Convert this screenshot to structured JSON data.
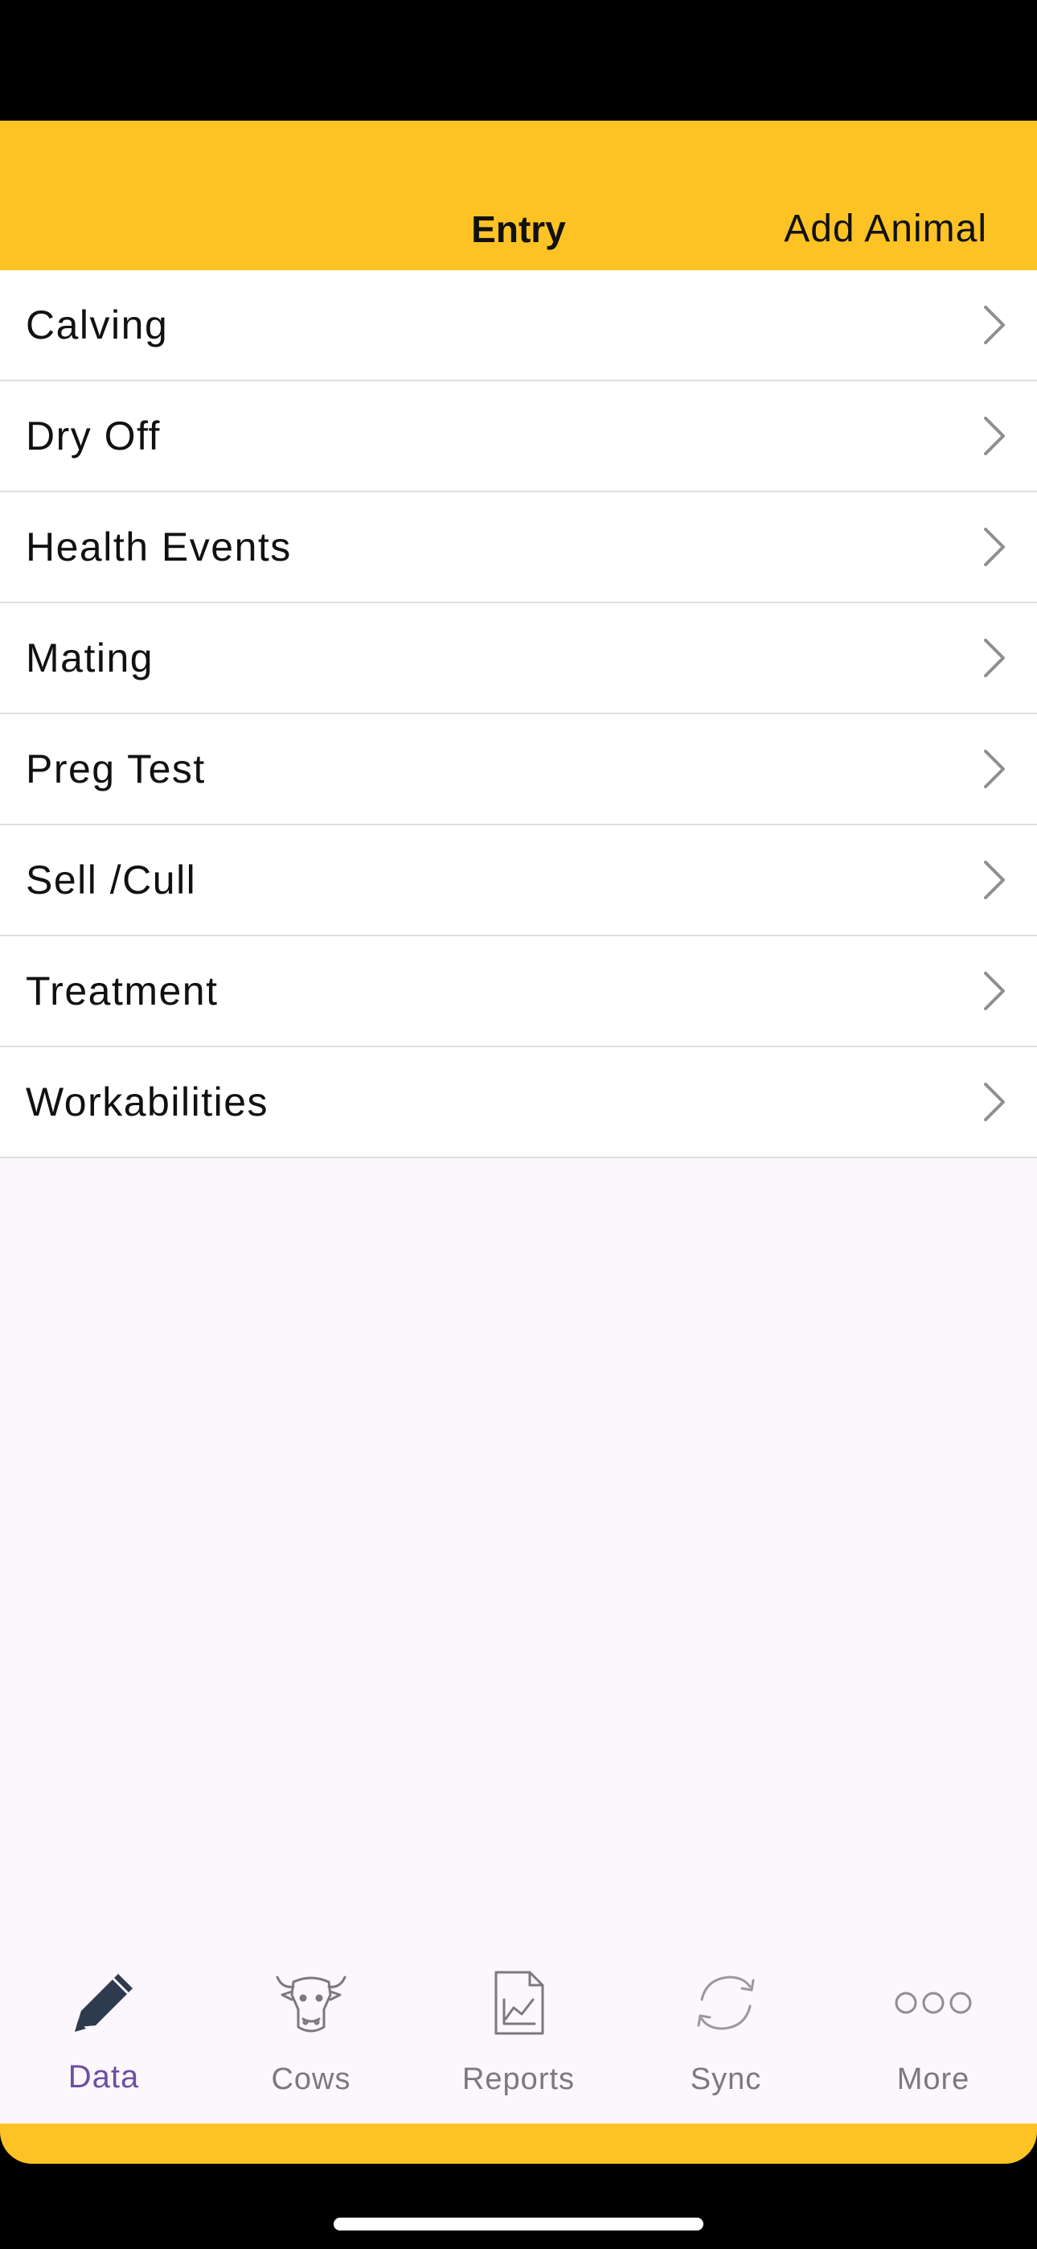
{
  "nav": {
    "title": "Entry",
    "action": "Add Animal"
  },
  "entries": [
    {
      "label": "Calving"
    },
    {
      "label": "Dry Off"
    },
    {
      "label": "Health Events"
    },
    {
      "label": "Mating"
    },
    {
      "label": "Preg Test"
    },
    {
      "label": "Sell /Cull"
    },
    {
      "label": "Treatment"
    },
    {
      "label": "Workabilities"
    }
  ],
  "tabs": [
    {
      "label": "Data",
      "icon": "pencil-icon",
      "active": true
    },
    {
      "label": "Cows",
      "icon": "cow-icon",
      "active": false
    },
    {
      "label": "Reports",
      "icon": "report-icon",
      "active": false
    },
    {
      "label": "Sync",
      "icon": "sync-icon",
      "active": false
    },
    {
      "label": "More",
      "icon": "more-icon",
      "active": false
    }
  ],
  "colors": {
    "accent": "#FDC324",
    "active_tab": "#6B4FA0",
    "inactive_tab": "#7A7A7E",
    "background": "#FCF6FD"
  }
}
